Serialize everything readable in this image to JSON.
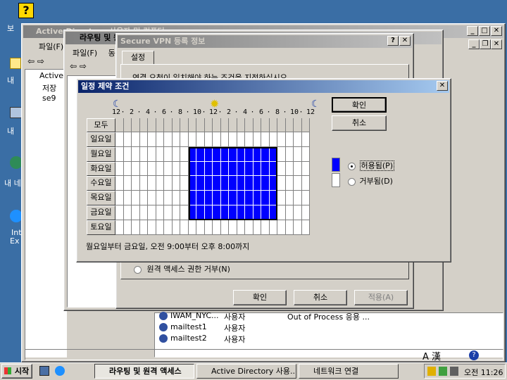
{
  "desktop": {
    "icons": [
      {
        "label": "보"
      },
      {
        "label": "내"
      },
      {
        "label": "내"
      },
      {
        "label": "내 네"
      },
      {
        "label": "Int"
      },
      {
        "label": "Ex"
      }
    ]
  },
  "ad_window": {
    "title": "Active Directory 사용자 및 컴퓨터",
    "menu_file": "파일(F)",
    "tree": [
      "Active",
      "저장",
      "se9"
    ]
  },
  "rras_window": {
    "title": "라우팅 및 원격 액세스",
    "menu": [
      "파일(F)",
      "동"
    ]
  },
  "vpn_dialog": {
    "title": "Secure VPN 등록 정보",
    "tab": "설정",
    "description": "연결 요청이 일치해야 하는 조건을 지정하십시오.",
    "deny_remote": "원격 액세스 권한 거부(N)",
    "ok": "확인",
    "cancel": "취소",
    "apply": "적용(A)"
  },
  "schedule_dialog": {
    "title": "일정 제약 조건",
    "ok": "확인",
    "cancel": "취소",
    "all_label": "모두",
    "days": [
      "일요일",
      "월요일",
      "화요일",
      "수요일",
      "목요일",
      "금요일",
      "토요일"
    ],
    "time_labels": [
      "12",
      "2",
      "4",
      "6",
      "8",
      "10",
      "12",
      "2",
      "4",
      "6",
      "8",
      "10",
      "12"
    ],
    "allow_label": "허용됨(P)",
    "deny_label": "거부됨(D)",
    "allow_color": "#0000ff",
    "deny_color": "#ffffff",
    "status": "월요일부터 금요일, 오전 9:00부터 오후 8:00까지",
    "allowed_days": [
      1,
      5
    ],
    "allowed_hours": [
      9,
      20
    ]
  },
  "user_list": [
    {
      "name": "IWAM_NYC...",
      "type": "사용자",
      "desc": "Out of Process 응용 ..."
    },
    {
      "name": "mailtest1",
      "type": "사용자",
      "desc": ""
    },
    {
      "name": "mailtest2",
      "type": "사용자",
      "desc": ""
    }
  ],
  "taskbar": {
    "start": "시작",
    "tasks": [
      "라우팅 및 원격 액세스",
      "Active Directory 사용...",
      "네트워크 연결"
    ],
    "clock": "오전 11:26"
  },
  "tray_text": "A 漢"
}
